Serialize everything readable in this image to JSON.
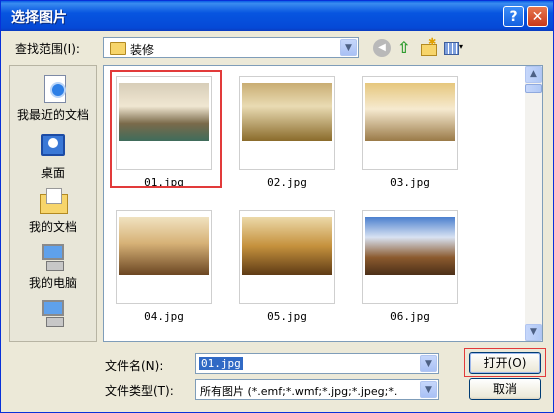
{
  "window": {
    "title": "选择图片",
    "help_glyph": "?",
    "close_glyph": "✕"
  },
  "lookin": {
    "label": "查找范围(I):",
    "value": "装修"
  },
  "toolbar": {
    "back_glyph": "◀",
    "up_glyph": "⇧",
    "views_dropdown_glyph": "▾"
  },
  "places": [
    {
      "label": "我最近的文档",
      "icon": "recent-documents-icon"
    },
    {
      "label": "桌面",
      "icon": "desktop-icon"
    },
    {
      "label": "我的文档",
      "icon": "my-documents-icon"
    },
    {
      "label": "我的电脑",
      "icon": "my-computer-icon"
    },
    {
      "label": "",
      "icon": "network-places-icon"
    }
  ],
  "files": [
    {
      "name": "01.jpg",
      "selected": true
    },
    {
      "name": "02.jpg",
      "selected": false
    },
    {
      "name": "03.jpg",
      "selected": false
    },
    {
      "name": "04.jpg",
      "selected": false
    },
    {
      "name": "05.jpg",
      "selected": false
    },
    {
      "name": "06.jpg",
      "selected": false
    }
  ],
  "filename": {
    "label": "文件名(N):",
    "value": "01.jpg"
  },
  "filetype": {
    "label": "文件类型(T):",
    "value": "所有图片 (*.emf;*.wmf;*.jpg;*.jpeg;*."
  },
  "buttons": {
    "open": "打开(O)",
    "cancel": "取消"
  },
  "colors": {
    "title_bar": "#0755e0",
    "dialog_bg": "#ece9d8",
    "selection": "#316ac5",
    "annotation_outline": "#e23a3a"
  }
}
